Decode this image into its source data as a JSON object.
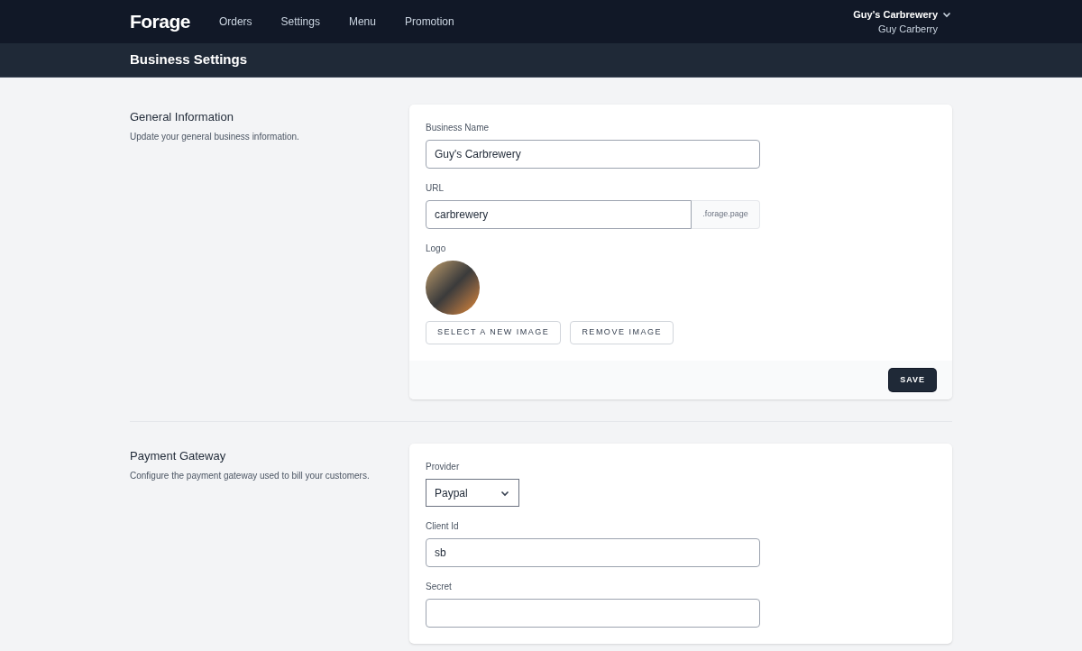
{
  "navbar": {
    "logo": "Forage",
    "links": [
      "Orders",
      "Settings",
      "Menu",
      "Promotion"
    ],
    "account": {
      "business": "Guy's Carbrewery",
      "user": "Guy Carberry"
    }
  },
  "page_header": {
    "title": "Business Settings"
  },
  "sections": [
    {
      "title": "General Information",
      "description": "Update your general business information.",
      "fields": [
        {
          "kind": "text",
          "label": "Business Name",
          "value": "Guy's Carbrewery"
        },
        {
          "kind": "url",
          "label": "URL",
          "value": "carbrewery",
          "suffix": ".forage.page"
        },
        {
          "kind": "logo",
          "label": "Logo",
          "buttons": [
            "SELECT A NEW IMAGE",
            "REMOVE IMAGE"
          ]
        }
      ],
      "footer_button": "SAVE"
    },
    {
      "title": "Payment Gateway",
      "description": "Configure the payment gateway used to bill your customers.",
      "fields": [
        {
          "kind": "select",
          "label": "Provider",
          "value": "Paypal"
        },
        {
          "kind": "text",
          "label": "Client Id",
          "value": "sb"
        },
        {
          "kind": "text",
          "label": "Secret"
        }
      ]
    }
  ]
}
